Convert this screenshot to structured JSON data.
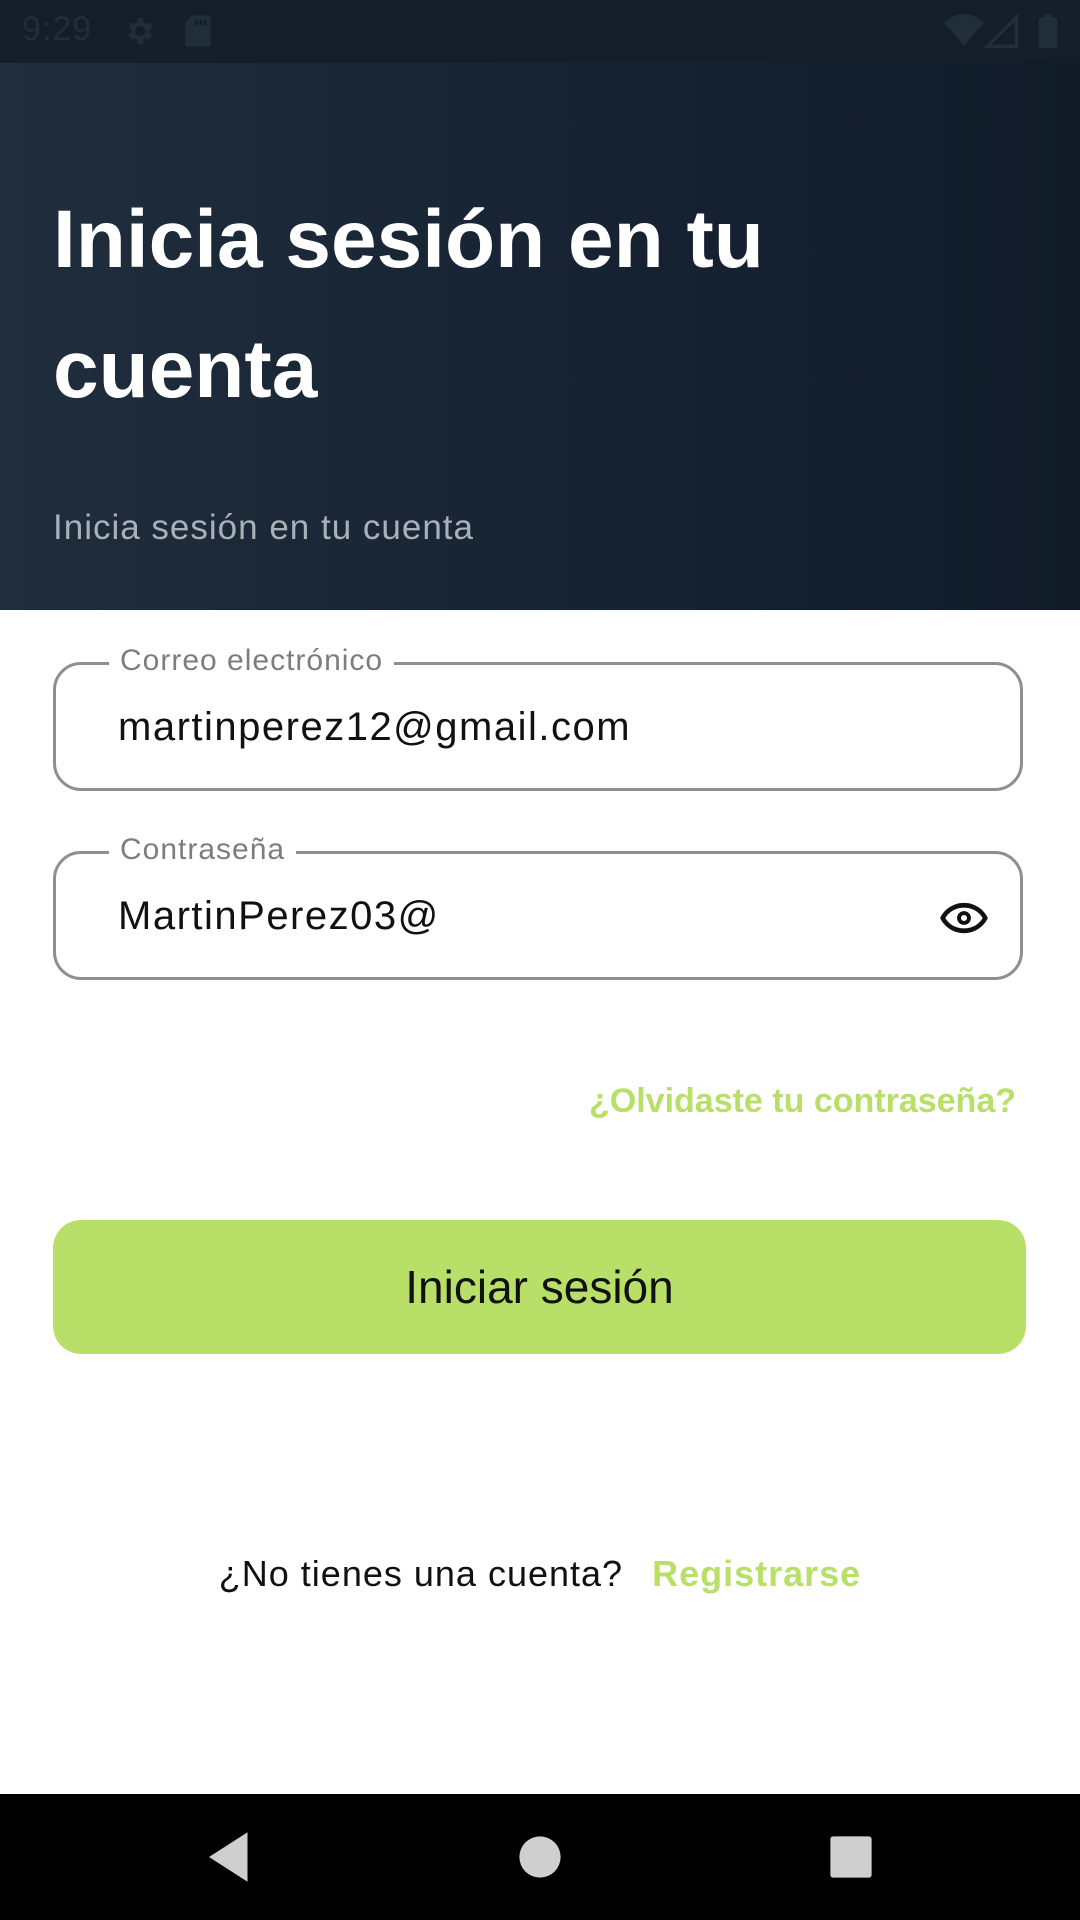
{
  "status_bar": {
    "time": "9:29",
    "icons_left": [
      "settings-icon",
      "sd-card-icon"
    ],
    "icons_right": [
      "wifi-icon",
      "signal-icon",
      "battery-icon"
    ]
  },
  "header": {
    "title": "Inicia sesión en tu cuenta",
    "subtitle": "Inicia sesión en tu cuenta",
    "gradient_colors": [
      "#1f2d3d",
      "#111b28"
    ]
  },
  "form": {
    "email": {
      "label": "Correo electrónico",
      "value": "martinperez12@gmail.com"
    },
    "password": {
      "label": "Contraseña",
      "value": "MartinPerez03@",
      "toggle_icon": "eye-icon"
    },
    "forgot_password": "¿Olvidaste tu contraseña?",
    "submit_label": "Iniciar sesión"
  },
  "register": {
    "prompt": "¿No tienes una cuenta?",
    "link": "Registrarse"
  },
  "nav_bar": {
    "buttons": [
      "back-icon",
      "home-icon",
      "recents-icon"
    ]
  },
  "colors": {
    "accent": "#b8e068",
    "header_bg": "#162232",
    "field_border": "#8f8f8f"
  }
}
